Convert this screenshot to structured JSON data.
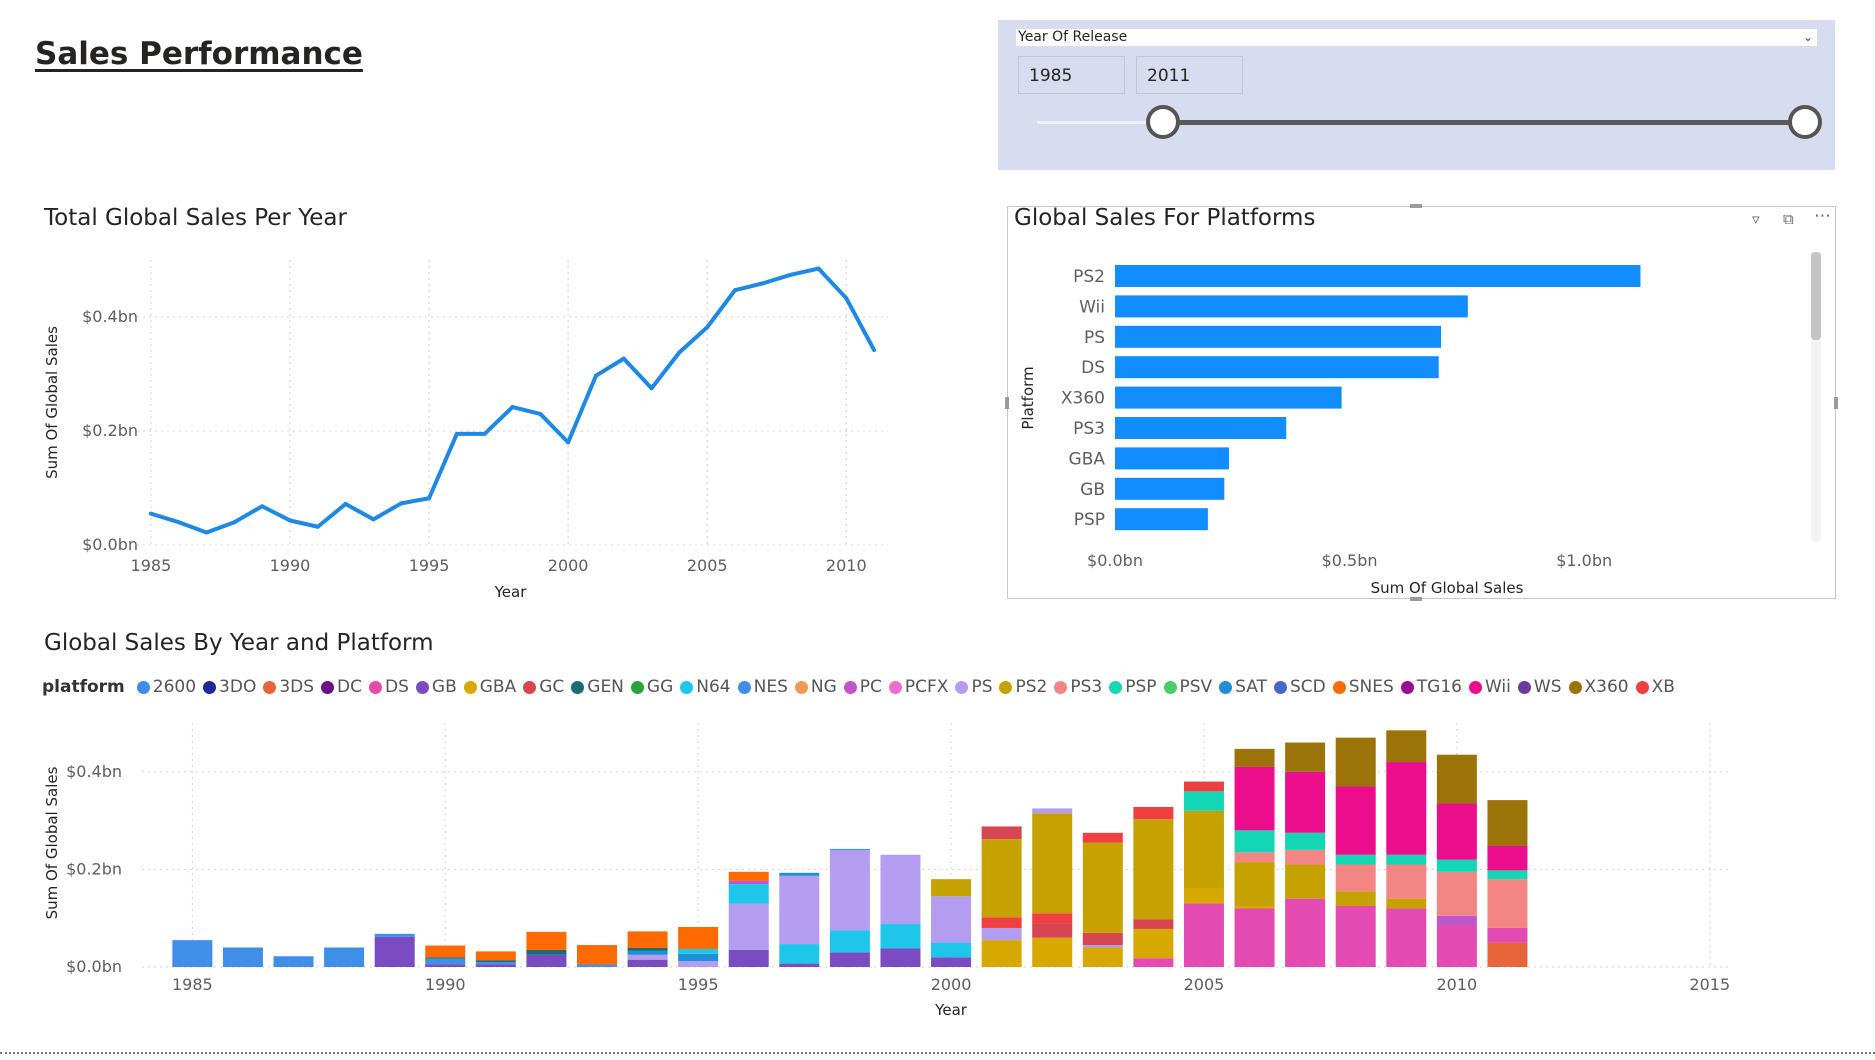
{
  "page": {
    "title": "Sales Performance"
  },
  "slicer": {
    "field": "Year Of Release",
    "from": "1985",
    "to": "2011",
    "range_fraction": [
      0.2,
      1.0
    ]
  },
  "colors": {
    "line": "#1e88e5",
    "bar": "#118dff",
    "grid": "#d0d0d0",
    "slicer_bg": "#d7dcf0"
  },
  "chart_data": [
    {
      "id": "line",
      "type": "line",
      "title": "Total Global Sales Per Year",
      "xlabel": "Year",
      "ylabel": "Sum Of Global Sales",
      "xlim": [
        1984.5,
        2011.5
      ],
      "ylim": [
        0,
        0.5
      ],
      "x_ticks": [
        1985,
        1990,
        1995,
        2000,
        2005,
        2010
      ],
      "y_ticks": [
        {
          "v": 0,
          "label": "$0.0bn"
        },
        {
          "v": 0.2,
          "label": "$0.2bn"
        },
        {
          "v": 0.4,
          "label": "$0.4bn"
        }
      ],
      "grid": true,
      "x": [
        1985,
        1986,
        1987,
        1988,
        1989,
        1990,
        1991,
        1992,
        1993,
        1994,
        1995,
        1996,
        1997,
        1998,
        1999,
        2000,
        2001,
        2002,
        2003,
        2004,
        2005,
        2006,
        2007,
        2008,
        2009,
        2010,
        2011
      ],
      "values": [
        0.055,
        0.04,
        0.022,
        0.04,
        0.068,
        0.043,
        0.032,
        0.072,
        0.045,
        0.073,
        0.082,
        0.195,
        0.195,
        0.242,
        0.23,
        0.18,
        0.297,
        0.327,
        0.275,
        0.338,
        0.382,
        0.447,
        0.459,
        0.474,
        0.485,
        0.433,
        0.342
      ]
    },
    {
      "id": "hbar",
      "type": "bar",
      "orientation": "horizontal",
      "title": "Global Sales For Platforms",
      "xlabel": "Sum Of Global Sales",
      "ylabel": "Platform",
      "xlim": [
        0,
        1.25
      ],
      "x_ticks": [
        {
          "v": 0,
          "label": "$0.0bn"
        },
        {
          "v": 0.5,
          "label": "$0.5bn"
        },
        {
          "v": 1.0,
          "label": "$1.0bn"
        }
      ],
      "categories": [
        "PS2",
        "Wii",
        "PS",
        "DS",
        "X360",
        "PS3",
        "GBA",
        "GB",
        "PSP"
      ],
      "values": [
        1.12,
        0.752,
        0.695,
        0.69,
        0.483,
        0.365,
        0.243,
        0.233,
        0.198
      ]
    },
    {
      "id": "stacked",
      "type": "bar",
      "stacked": true,
      "title": "Global Sales By Year and Platform",
      "xlabel": "Year",
      "ylabel": "Sum Of Global Sales",
      "legend_title": "platform",
      "legend_position": "top-left",
      "xlim": [
        1984.4,
        2015.4
      ],
      "ylim": [
        0,
        0.5
      ],
      "x_ticks": [
        1985,
        1990,
        1995,
        2000,
        2005,
        2010,
        2015
      ],
      "y_ticks": [
        {
          "v": 0,
          "label": "$0.0bn"
        },
        {
          "v": 0.2,
          "label": "$0.2bn"
        },
        {
          "v": 0.4,
          "label": "$0.4bn"
        }
      ],
      "legend": [
        {
          "name": "2600",
          "color": "#3b8eea"
        },
        {
          "name": "3DO",
          "color": "#1f2a99"
        },
        {
          "name": "3DS",
          "color": "#e8653a"
        },
        {
          "name": "DC",
          "color": "#6b0f86"
        },
        {
          "name": "DS",
          "color": "#e34bb2"
        },
        {
          "name": "GB",
          "color": "#7b4cc1"
        },
        {
          "name": "GBA",
          "color": "#d6a800"
        },
        {
          "name": "GC",
          "color": "#d64550"
        },
        {
          "name": "GEN",
          "color": "#1a6b74"
        },
        {
          "name": "GG",
          "color": "#2ba33b"
        },
        {
          "name": "N64",
          "color": "#1ec6ea"
        },
        {
          "name": "NES",
          "color": "#3f8fe8"
        },
        {
          "name": "NG",
          "color": "#f19a55"
        },
        {
          "name": "PC",
          "color": "#bf56c9"
        },
        {
          "name": "PCFX",
          "color": "#ee6ec8"
        },
        {
          "name": "PS",
          "color": "#b39df0"
        },
        {
          "name": "PS2",
          "color": "#c6a200"
        },
        {
          "name": "PS3",
          "color": "#f48585"
        },
        {
          "name": "PSP",
          "color": "#14d6b5"
        },
        {
          "name": "PSV",
          "color": "#4ccc63"
        },
        {
          "name": "SAT",
          "color": "#1e8fd4"
        },
        {
          "name": "SCD",
          "color": "#4966c8"
        },
        {
          "name": "SNES",
          "color": "#ff6a00"
        },
        {
          "name": "TG16",
          "color": "#980f8d"
        },
        {
          "name": "Wii",
          "color": "#ec0d8d"
        },
        {
          "name": "WS",
          "color": "#6a3c9c"
        },
        {
          "name": "X360",
          "color": "#9b7308"
        },
        {
          "name": "XB",
          "color": "#ef3f40"
        }
      ],
      "stacks": [
        {
          "year": 1985,
          "segments": [
            [
              "NES",
              0.055
            ]
          ]
        },
        {
          "year": 1986,
          "segments": [
            [
              "NES",
              0.04
            ]
          ]
        },
        {
          "year": 1987,
          "segments": [
            [
              "NES",
              0.022
            ]
          ]
        },
        {
          "year": 1988,
          "segments": [
            [
              "NES",
              0.04
            ]
          ]
        },
        {
          "year": 1989,
          "segments": [
            [
              "GB",
              0.062
            ],
            [
              "NES",
              0.006
            ]
          ]
        },
        {
          "year": 1990,
          "segments": [
            [
              "GB",
              0.005
            ],
            [
              "NES",
              0.012
            ],
            [
              "GEN",
              0.003
            ],
            [
              "SNES",
              0.024
            ]
          ]
        },
        {
          "year": 1991,
          "segments": [
            [
              "GB",
              0.005
            ],
            [
              "NES",
              0.005
            ],
            [
              "GEN",
              0.004
            ],
            [
              "SNES",
              0.018
            ]
          ]
        },
        {
          "year": 1992,
          "segments": [
            [
              "GB",
              0.025
            ],
            [
              "GEN",
              0.01
            ],
            [
              "SNES",
              0.037
            ]
          ]
        },
        {
          "year": 1993,
          "segments": [
            [
              "NES",
              0.005
            ],
            [
              "SNES",
              0.04
            ]
          ]
        },
        {
          "year": 1994,
          "segments": [
            [
              "GB",
              0.015
            ],
            [
              "PS",
              0.01
            ],
            [
              "SAT",
              0.008
            ],
            [
              "GEN",
              0.006
            ],
            [
              "SNES",
              0.034
            ]
          ]
        },
        {
          "year": 1995,
          "segments": [
            [
              "PS",
              0.012
            ],
            [
              "SAT",
              0.015
            ],
            [
              "N64",
              0.01
            ],
            [
              "SNES",
              0.045
            ]
          ]
        },
        {
          "year": 1996,
          "segments": [
            [
              "GB",
              0.035
            ],
            [
              "PS",
              0.095
            ],
            [
              "N64",
              0.04
            ],
            [
              "PC",
              0.007
            ],
            [
              "SNES",
              0.018
            ]
          ]
        },
        {
          "year": 1997,
          "segments": [
            [
              "GB",
              0.007
            ],
            [
              "N64",
              0.04
            ],
            [
              "PS",
              0.14
            ],
            [
              "SAT",
              0.006
            ]
          ]
        },
        {
          "year": 1998,
          "segments": [
            [
              "GB",
              0.03
            ],
            [
              "N64",
              0.045
            ],
            [
              "PS",
              0.165
            ],
            [
              "SAT",
              0.002
            ]
          ]
        },
        {
          "year": 1999,
          "segments": [
            [
              "GB",
              0.038
            ],
            [
              "N64",
              0.05
            ],
            [
              "PS",
              0.142
            ]
          ]
        },
        {
          "year": 2000,
          "segments": [
            [
              "GB",
              0.02
            ],
            [
              "N64",
              0.03
            ],
            [
              "PS",
              0.095
            ],
            [
              "PS2",
              0.035
            ]
          ]
        },
        {
          "year": 2001,
          "segments": [
            [
              "GBA",
              0.055
            ],
            [
              "PS",
              0.025
            ],
            [
              "XB",
              0.022
            ],
            [
              "PS2",
              0.16
            ],
            [
              "GC",
              0.026
            ]
          ]
        },
        {
          "year": 2002,
          "segments": [
            [
              "GBA",
              0.06
            ],
            [
              "GC",
              0.03
            ],
            [
              "XB",
              0.02
            ],
            [
              "PS2",
              0.205
            ],
            [
              "PS",
              0.01
            ]
          ]
        },
        {
          "year": 2003,
          "segments": [
            [
              "GBA",
              0.04
            ],
            [
              "PS",
              0.005
            ],
            [
              "GC",
              0.025
            ],
            [
              "PS2",
              0.185
            ],
            [
              "XB",
              0.02
            ]
          ]
        },
        {
          "year": 2004,
          "segments": [
            [
              "DS",
              0.018
            ],
            [
              "GBA",
              0.06
            ],
            [
              "GC",
              0.02
            ],
            [
              "PS2",
              0.205
            ],
            [
              "XB",
              0.025
            ]
          ]
        },
        {
          "year": 2005,
          "segments": [
            [
              "DS",
              0.13
            ],
            [
              "GBA",
              0.03
            ],
            [
              "PS2",
              0.16
            ],
            [
              "PSP",
              0.04
            ],
            [
              "XB",
              0.02
            ]
          ]
        },
        {
          "year": 2006,
          "segments": [
            [
              "DS",
              0.12
            ],
            [
              "GBA",
              0.005
            ],
            [
              "PS2",
              0.09
            ],
            [
              "PS3",
              0.02
            ],
            [
              "PSP",
              0.045
            ],
            [
              "Wii",
              0.13
            ],
            [
              "X360",
              0.037
            ]
          ]
        },
        {
          "year": 2007,
          "segments": [
            [
              "DS",
              0.14
            ],
            [
              "PS2",
              0.07
            ],
            [
              "PS3",
              0.03
            ],
            [
              "PSP",
              0.035
            ],
            [
              "Wii",
              0.125
            ],
            [
              "X360",
              0.06
            ]
          ]
        },
        {
          "year": 2008,
          "segments": [
            [
              "DS",
              0.125
            ],
            [
              "PS2",
              0.03
            ],
            [
              "PS3",
              0.055
            ],
            [
              "PSP",
              0.02
            ],
            [
              "Wii",
              0.14
            ],
            [
              "X360",
              0.1
            ]
          ]
        },
        {
          "year": 2009,
          "segments": [
            [
              "DS",
              0.12
            ],
            [
              "PS2",
              0.02
            ],
            [
              "PS3",
              0.07
            ],
            [
              "PSP",
              0.02
            ],
            [
              "Wii",
              0.19
            ],
            [
              "X360",
              0.065
            ]
          ]
        },
        {
          "year": 2010,
          "segments": [
            [
              "DS",
              0.085
            ],
            [
              "PC",
              0.02
            ],
            [
              "PS3",
              0.09
            ],
            [
              "PSP",
              0.025
            ],
            [
              "Wii",
              0.115
            ],
            [
              "X360",
              0.1
            ]
          ]
        },
        {
          "year": 2011,
          "segments": [
            [
              "3DS",
              0.05
            ],
            [
              "DS",
              0.03
            ],
            [
              "PS3",
              0.1
            ],
            [
              "PSP",
              0.018
            ],
            [
              "Wii",
              0.05
            ],
            [
              "X360",
              0.094
            ]
          ]
        }
      ]
    }
  ]
}
